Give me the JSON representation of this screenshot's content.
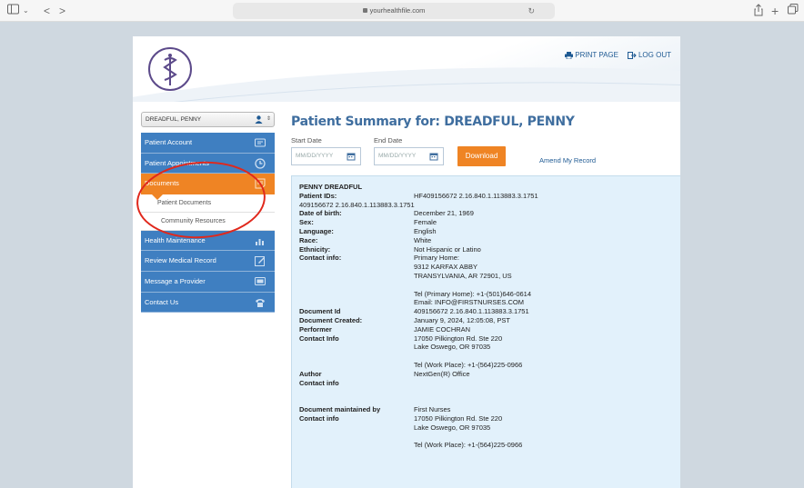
{
  "browser": {
    "url": "yourhealthfile.com"
  },
  "header": {
    "print_label": "PRINT PAGE",
    "logout_label": "LOG OUT"
  },
  "sidebar": {
    "patient_select_value": "DREADFUL, PENNY",
    "items": [
      {
        "label": "Patient Account",
        "icon": "id-card-icon"
      },
      {
        "label": "Patient Appointments",
        "icon": "clock-icon"
      },
      {
        "label": "Documents",
        "icon": "document-icon"
      },
      {
        "label": "Health Maintenance",
        "icon": "bar-chart-icon"
      },
      {
        "label": "Review Medical Record",
        "icon": "edit-icon"
      },
      {
        "label": "Message a Provider",
        "icon": "monitor-icon"
      },
      {
        "label": "Contact Us",
        "icon": "phone-icon"
      }
    ],
    "sub_items": [
      "Patient Documents",
      "Community Resources"
    ]
  },
  "main": {
    "title": "Patient Summary for: DREADFUL, PENNY",
    "start_date_label": "Start Date",
    "end_date_label": "End Date",
    "start_date_placeholder": "MM/DD/YYYY",
    "end_date_placeholder": "MM/DD/YYYY",
    "download_label": "Download",
    "amend_label": "Amend My Record"
  },
  "summary": {
    "name": "PENNY DREADFUL",
    "patient_ids_label": "Patient IDs:",
    "patient_ids_value": "HF409156672 2.16.840.1.113883.3.1751",
    "patient_ids_cont": "409156672 2.16.840.1.113883.3.1751",
    "dob_label": "Date of birth:",
    "dob_value": "December 21, 1969",
    "sex_label": "Sex:",
    "sex_value": "Female",
    "language_label": "Language:",
    "language_value": "English",
    "race_label": "Race:",
    "race_value": "White",
    "ethnicity_label": "Ethnicity:",
    "ethnicity_value": "Not Hispanic or Latino",
    "contact_label": "Contact info:",
    "contact_lines": [
      "Primary Home:",
      "9312 KARFAX ABBY",
      "TRANSYLVANIA, AR 72901, US"
    ],
    "contact_tel": "Tel (Primary Home): +1-(501)646-0614",
    "contact_email": "Email: INFO@FIRSTNURSES.COM",
    "document_id_label": "Document Id",
    "document_id_value": "409156672 2.16.840.1.113883.3.1751",
    "document_created_label": "Document Created:",
    "document_created_value": "January 9, 2024, 12:05:08, PST",
    "performer_label": "Performer",
    "performer_value": "JAMIE COCHRAN",
    "perf_contact_label": "Contact Info",
    "perf_contact_lines": [
      "17050 Pilkington Rd. Ste 220",
      "Lake Oswego, OR 97035"
    ],
    "perf_tel": "Tel (Work Place): +1-(564)225-0966",
    "author_label": "Author",
    "author_value": "NextGen(R) Office",
    "author_contact_label": "Contact info",
    "maintained_label": "Document maintained by",
    "maintained_value": "First Nurses",
    "maint_contact_label": "Contact info",
    "maint_contact_lines": [
      "17050 Pilkington Rd. Ste 220",
      "Lake Oswego, OR 97035"
    ],
    "maint_tel": "Tel (Work Place): +1-(564)225-0966"
  },
  "colors": {
    "nav_blue": "#3f7fc1",
    "nav_active": "#ef8424",
    "title_blue": "#3f6e9f",
    "annotation_red": "#e0281c"
  }
}
